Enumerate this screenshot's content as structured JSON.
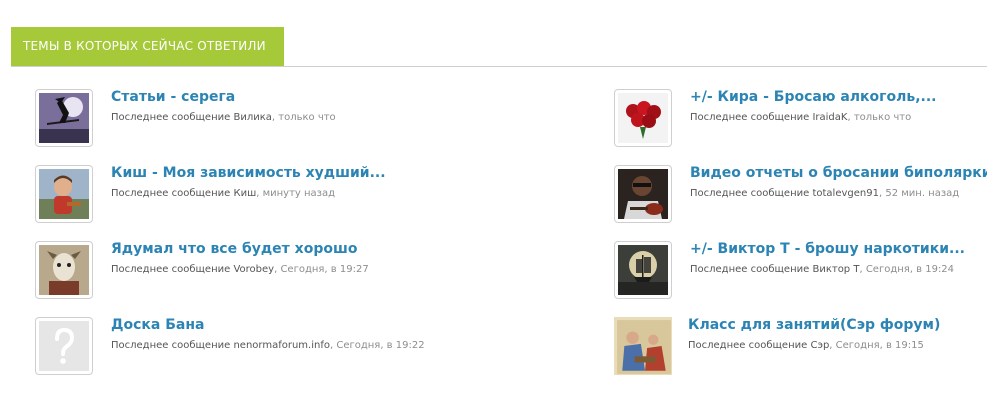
{
  "section": {
    "title": "ТЕМЫ В КОТОРЫХ СЕЙЧАС ОТВЕТИЛИ"
  },
  "topics_left": [
    {
      "title": "Статьи - серега",
      "last_label": "Последнее сообщение",
      "author": "Вилика",
      "time": "только что",
      "avatar": "witch-avatar"
    },
    {
      "title": "Киш - Моя зависимость худший...",
      "last_label": "Последнее сообщение",
      "author": "Киш",
      "time": "минуту назад",
      "avatar": "child-avatar"
    },
    {
      "title": "Ядумал что все будет хорошо",
      "last_label": "Последнее сообщение",
      "author": "Vorobey",
      "time": "Сегодня, в 19:27",
      "avatar": "animal-avatar"
    },
    {
      "title": "Доска Бана",
      "last_label": "Последнее сообщение",
      "author": "nenormaforum.info",
      "time": "Сегодня, в 19:22",
      "avatar": "question-avatar"
    }
  ],
  "topics_right": [
    {
      "title": "+/- Кира - Бросаю алкоголь,...",
      "last_label": "Последнее сообщение",
      "author": "IraidaK",
      "time": "только что",
      "avatar": "roses-avatar"
    },
    {
      "title": "Видео отчеты о бросании биполярки",
      "last_label": "Последнее сообщение",
      "author": "totalevgen91",
      "time": "52 мин. назад",
      "avatar": "guitarist-avatar"
    },
    {
      "title": "+/- Виктор Т - брошу наркотики...",
      "last_label": "Последнее сообщение",
      "author": "Виктор Т",
      "time": "Сегодня, в 19:24",
      "avatar": "ship-avatar"
    },
    {
      "title": "Класс для занятий(Сэр форум)",
      "last_label": "Последнее сообщение",
      "author": "Сэр",
      "time": "Сегодня, в 19:15",
      "avatar": "painting-avatar"
    }
  ],
  "colors": {
    "accent": "#a6c93a",
    "link": "#2b84b3",
    "meta_text": "#555555",
    "time_text": "#8d8d8d"
  }
}
